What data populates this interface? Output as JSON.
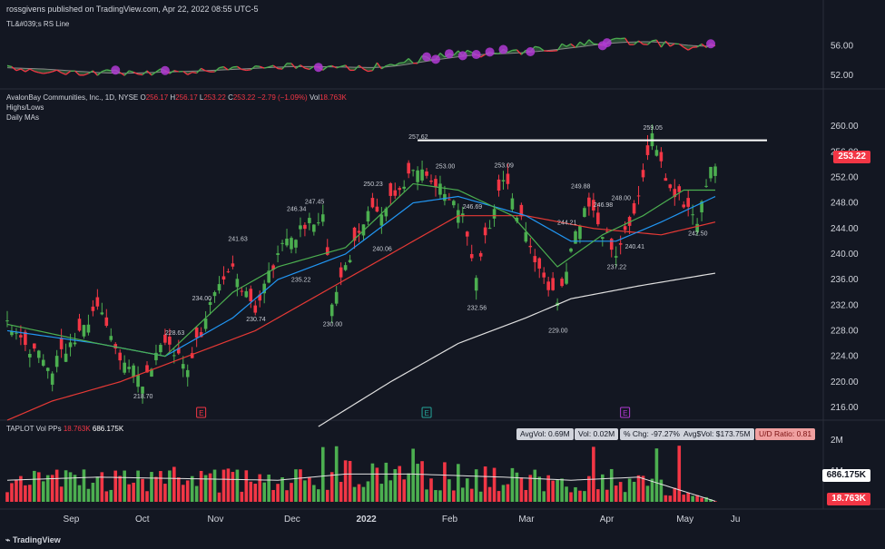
{
  "header": {
    "publisher": "rossgivens published on TradingView.com, Apr 22, 2022 08:55 UTC-5"
  },
  "rs_panel": {
    "label": "TL&#039;s RS Line",
    "ticks": [
      "56.00",
      "52.00"
    ]
  },
  "main_panel": {
    "symbol_line": "AvalonBay Communities, Inc., 1D, NYSE",
    "ohlc": {
      "O_label": "O",
      "O": "256.17",
      "H_label": "H",
      "H": "256.17",
      "L_label": "L",
      "L": "253.22",
      "C_label": "C",
      "C": "253.22",
      "chg": "−2.79 (−1.09%)",
      "vol_label": "Vol",
      "vol": "18.763K"
    },
    "study1": "Highs/Lows",
    "study2": "Daily MAs",
    "price_ticks": [
      "260.00",
      "256.00",
      "252.00",
      "248.00",
      "244.00",
      "240.00",
      "236.00",
      "232.00",
      "228.00",
      "224.00",
      "220.00",
      "216.00"
    ],
    "last_price": "253.22",
    "earnings_markers": [
      "E",
      "E",
      "E"
    ]
  },
  "volume_panel": {
    "label": "TAPLOT Vol PPs",
    "vol_red": "18.763K",
    "vol_white": "686.175K",
    "stats": {
      "avgvol": "AvgVol: 0.69M",
      "vol": "Vol: 0.02M",
      "pchg": "% Chg: -97.27%",
      "avgdollar": "Avg$Vol: $173.75M",
      "ud": "U/D Ratio: 0.81"
    },
    "ticks": [
      "2M",
      "1M"
    ],
    "badge_white": "686.175K",
    "badge_red": "18.763K"
  },
  "time_axis": [
    "Sep",
    "Oct",
    "Nov",
    "Dec",
    "2022",
    "Feb",
    "Mar",
    "Apr",
    "May",
    "Ju"
  ],
  "footer": {
    "brand": "TradingView"
  },
  "colors": {
    "bg": "#131722",
    "up": "#26a69a",
    "green": "#4caf50",
    "red": "#f23645",
    "ma_green": "#4caf50",
    "ma_blue": "#2196f3",
    "ma_red": "#e53935",
    "ma_white": "#e0e0e0",
    "purple": "#b23ad3"
  },
  "chart_data": {
    "type": "candlestick",
    "price_range": [
      214,
      262
    ],
    "resistance_level": 257.8,
    "pivot_labels": [
      {
        "day": 30,
        "price": 218.7,
        "label": "218.70"
      },
      {
        "day": 37,
        "price": 228.63,
        "label": "228.63"
      },
      {
        "day": 43,
        "price": 234.0,
        "label": "234.00"
      },
      {
        "day": 51,
        "price": 241.63,
        "label": "241.63"
      },
      {
        "day": 55,
        "price": 230.74,
        "label": "230.74"
      },
      {
        "day": 64,
        "price": 246.34,
        "label": "246.34"
      },
      {
        "day": 65,
        "price": 235.22,
        "label": "235.22"
      },
      {
        "day": 68,
        "price": 247.45,
        "label": "247.45"
      },
      {
        "day": 72,
        "price": 230.0,
        "label": "230.00"
      },
      {
        "day": 81,
        "price": 250.23,
        "label": "250.23"
      },
      {
        "day": 83,
        "price": 240.06,
        "label": "240.06"
      },
      {
        "day": 91,
        "price": 257.62,
        "label": "257.62"
      },
      {
        "day": 97,
        "price": 253.0,
        "label": "253.00"
      },
      {
        "day": 103,
        "price": 246.69,
        "label": "246.69"
      },
      {
        "day": 104,
        "price": 232.56,
        "label": "232.56"
      },
      {
        "day": 110,
        "price": 253.09,
        "label": "253.09"
      },
      {
        "day": 122,
        "price": 229.0,
        "label": "229.00"
      },
      {
        "day": 127,
        "price": 249.88,
        "label": "249.88"
      },
      {
        "day": 124,
        "price": 244.21,
        "label": "244.21"
      },
      {
        "day": 132,
        "price": 246.98,
        "label": "246.98"
      },
      {
        "day": 135,
        "price": 237.22,
        "label": "237.22"
      },
      {
        "day": 136,
        "price": 248.0,
        "label": "248.00"
      },
      {
        "day": 139,
        "price": 240.41,
        "label": "240.41"
      },
      {
        "day": 143,
        "price": 259.05,
        "label": "259.05"
      },
      {
        "day": 153,
        "price": 242.5,
        "label": "242.50"
      }
    ],
    "price_anchors": [
      [
        0,
        229
      ],
      [
        5,
        225
      ],
      [
        10,
        222
      ],
      [
        15,
        227
      ],
      [
        20,
        232
      ],
      [
        25,
        224
      ],
      [
        30,
        220
      ],
      [
        35,
        226
      ],
      [
        40,
        222
      ],
      [
        45,
        232
      ],
      [
        50,
        238
      ],
      [
        55,
        231
      ],
      [
        60,
        240
      ],
      [
        65,
        244
      ],
      [
        70,
        246
      ],
      [
        72,
        232
      ],
      [
        76,
        240
      ],
      [
        80,
        246
      ],
      [
        85,
        248
      ],
      [
        90,
        254
      ],
      [
        93,
        252
      ],
      [
        97,
        250
      ],
      [
        101,
        246
      ],
      [
        104,
        236
      ],
      [
        108,
        248
      ],
      [
        110,
        252
      ],
      [
        114,
        245
      ],
      [
        118,
        238
      ],
      [
        122,
        232
      ],
      [
        125,
        240
      ],
      [
        128,
        248
      ],
      [
        131,
        245
      ],
      [
        135,
        240
      ],
      [
        138,
        245
      ],
      [
        141,
        252
      ],
      [
        143,
        258
      ],
      [
        146,
        252
      ],
      [
        150,
        248
      ],
      [
        153,
        245
      ],
      [
        156,
        254
      ],
      [
        157,
        253.22
      ]
    ],
    "ma_green_anchors": [
      [
        0,
        229
      ],
      [
        20,
        226
      ],
      [
        35,
        224
      ],
      [
        50,
        234
      ],
      [
        60,
        238
      ],
      [
        75,
        241
      ],
      [
        90,
        251
      ],
      [
        100,
        250
      ],
      [
        112,
        246
      ],
      [
        122,
        238
      ],
      [
        132,
        243
      ],
      [
        141,
        246
      ],
      [
        150,
        250
      ],
      [
        157,
        250
      ]
    ],
    "ma_blue_anchors": [
      [
        0,
        228
      ],
      [
        20,
        226
      ],
      [
        35,
        224
      ],
      [
        50,
        230
      ],
      [
        60,
        236
      ],
      [
        75,
        240
      ],
      [
        90,
        248
      ],
      [
        100,
        249
      ],
      [
        115,
        246
      ],
      [
        125,
        242
      ],
      [
        135,
        242
      ],
      [
        145,
        245
      ],
      [
        157,
        249
      ]
    ],
    "ma_red_anchors": [
      [
        0,
        214
      ],
      [
        10,
        217
      ],
      [
        25,
        220
      ],
      [
        40,
        224
      ],
      [
        55,
        228
      ],
      [
        70,
        234
      ],
      [
        85,
        240
      ],
      [
        100,
        246
      ],
      [
        115,
        246
      ],
      [
        130,
        244
      ],
      [
        145,
        243
      ],
      [
        157,
        245
      ]
    ],
    "ma_white_anchors": [
      [
        69,
        213
      ],
      [
        85,
        220
      ],
      [
        100,
        226
      ],
      [
        115,
        230
      ],
      [
        125,
        233
      ],
      [
        140,
        235
      ],
      [
        157,
        237
      ]
    ],
    "rs_line_anchors": [
      [
        0,
        53.0
      ],
      [
        20,
        52.2
      ],
      [
        40,
        52.6
      ],
      [
        60,
        53.2
      ],
      [
        80,
        53.0
      ],
      [
        90,
        54.0
      ],
      [
        100,
        54.8
      ],
      [
        110,
        55.0
      ],
      [
        120,
        55.6
      ],
      [
        130,
        56.4
      ],
      [
        140,
        56.6
      ],
      [
        150,
        55.8
      ],
      [
        157,
        56.2
      ]
    ],
    "volume_M_anchors": [
      [
        0,
        0.7
      ],
      [
        20,
        0.8
      ],
      [
        40,
        0.75
      ],
      [
        60,
        0.7
      ],
      [
        75,
        0.9
      ],
      [
        90,
        0.9
      ],
      [
        110,
        0.8
      ],
      [
        125,
        0.7
      ],
      [
        140,
        0.8
      ],
      [
        157,
        0.02
      ]
    ]
  }
}
